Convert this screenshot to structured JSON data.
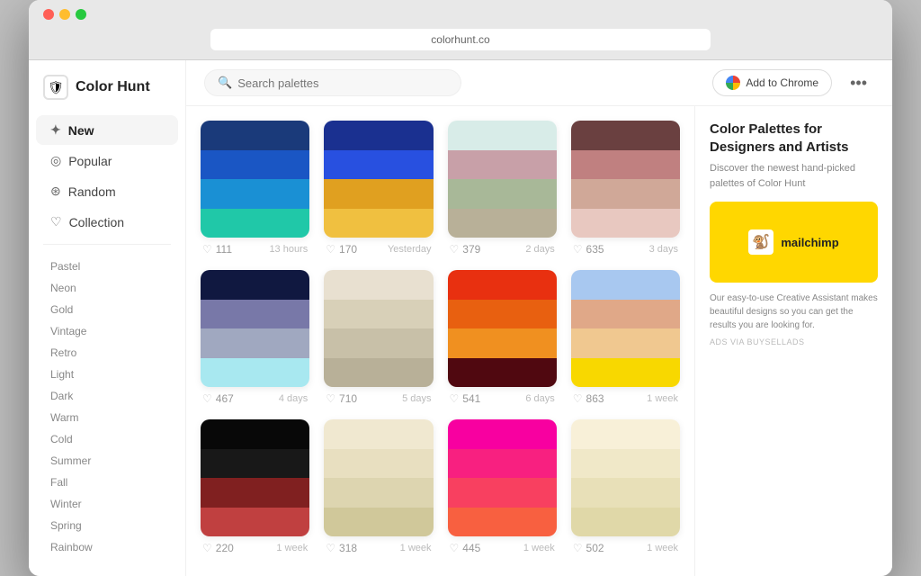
{
  "brand": {
    "name": "Color Hunt",
    "icon": "🛡"
  },
  "search": {
    "placeholder": "Search palettes"
  },
  "nav": {
    "items": [
      {
        "id": "new",
        "label": "New",
        "icon": "✦",
        "active": true
      },
      {
        "id": "popular",
        "label": "Popular",
        "icon": "◎"
      },
      {
        "id": "random",
        "label": "Random",
        "icon": "◈"
      },
      {
        "id": "collection",
        "label": "Collection",
        "icon": "♡"
      }
    ]
  },
  "tags": [
    "Pastel",
    "Neon",
    "Gold",
    "Vintage",
    "Retro",
    "Light",
    "Dark",
    "Warm",
    "Cold",
    "Summer",
    "Fall",
    "Winter",
    "Spring",
    "Rainbow"
  ],
  "add_chrome": "Add to Chrome",
  "more_icon": "•••",
  "right_panel": {
    "title": "Color Palettes for Designers and Artists",
    "desc": "Discover the newest hand-picked palettes of Color Hunt",
    "ad_text": "Our easy-to-use Creative Assistant makes beautiful designs so you can get the results you are looking for.",
    "ad_label": "ADS VIA BUYSELLADS",
    "mailchimp_label": "mailchimp"
  },
  "palettes": [
    {
      "id": 1,
      "likes": 111,
      "time": "13 hours",
      "swatches": [
        "#1a3a7a",
        "#1a56c4",
        "#1a90d4",
        "#20c8a8"
      ]
    },
    {
      "id": 2,
      "likes": 170,
      "time": "Yesterday",
      "swatches": [
        "#1a3090",
        "#2850e0",
        "#e0a020",
        "#f0c040"
      ]
    },
    {
      "id": 3,
      "likes": 379,
      "time": "2 days",
      "swatches": [
        "#d8ece8",
        "#c8a0a8",
        "#a8b898",
        "#b8b098"
      ]
    },
    {
      "id": 4,
      "likes": 635,
      "time": "3 days",
      "swatches": [
        "#6a4040",
        "#c08080",
        "#d0a898",
        "#e8c8c0"
      ]
    },
    {
      "id": 5,
      "likes": 467,
      "time": "4 days",
      "swatches": [
        "#101840",
        "#7878a8",
        "#a0a8c0",
        "#a8e8f0"
      ]
    },
    {
      "id": 6,
      "likes": 710,
      "time": "5 days",
      "swatches": [
        "#e8e0d0",
        "#d8d0b8",
        "#c8c0a8",
        "#b8b098"
      ]
    },
    {
      "id": 7,
      "likes": 541,
      "time": "6 days",
      "swatches": [
        "#e83010",
        "#e86010",
        "#f09020",
        "#500810"
      ]
    },
    {
      "id": 8,
      "likes": 863,
      "time": "1 week",
      "swatches": [
        "#a8c8f0",
        "#e0a888",
        "#f0c890",
        "#f8d800"
      ]
    },
    {
      "id": 9,
      "likes": 220,
      "time": "1 week",
      "swatches": [
        "#080808",
        "#181818",
        "#802020",
        "#c04040"
      ]
    },
    {
      "id": 10,
      "likes": 318,
      "time": "1 week",
      "swatches": [
        "#f0e8d0",
        "#e8dfc0",
        "#ddd5b0",
        "#d0c89a"
      ]
    },
    {
      "id": 11,
      "likes": 445,
      "time": "1 week",
      "swatches": [
        "#f800a0",
        "#f82080",
        "#f84060",
        "#f86040"
      ]
    },
    {
      "id": 12,
      "likes": 502,
      "time": "1 week",
      "swatches": [
        "#f8f0d8",
        "#f0e8c8",
        "#e8e0b8",
        "#e0d8a8"
      ]
    }
  ]
}
